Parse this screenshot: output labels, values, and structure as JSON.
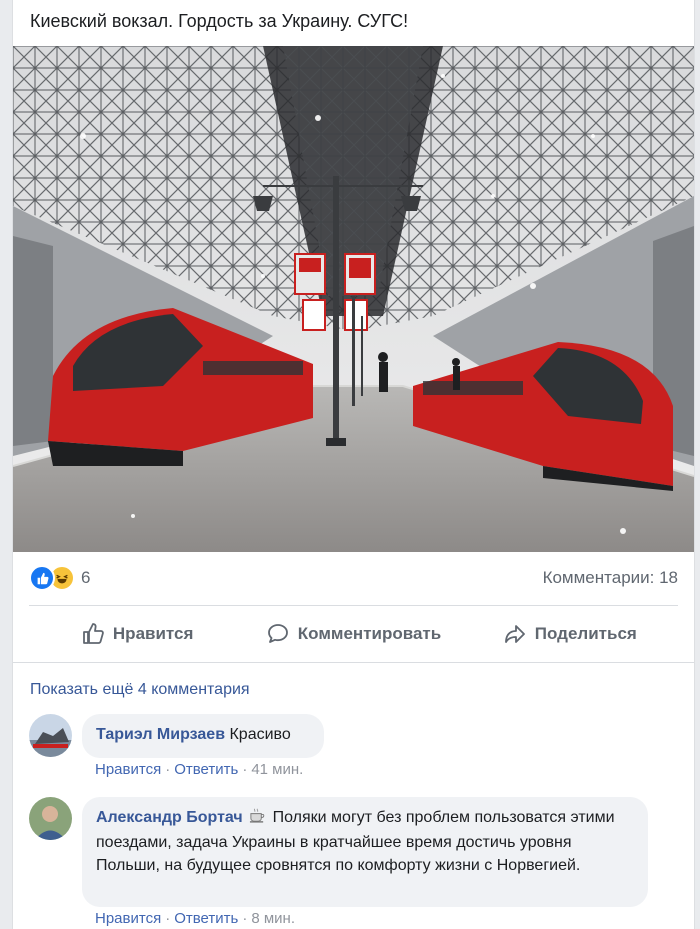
{
  "post": {
    "text": "Киевский вокзал. Гордость за Украину. СУГС!",
    "reactions": {
      "icons": [
        "like-icon",
        "haha-icon"
      ],
      "count": "6"
    },
    "comments_count": "Комментарии: 18",
    "actions": {
      "like": "Нравится",
      "comment": "Комментировать",
      "share": "Поделиться"
    }
  },
  "comments": {
    "show_more": "Показать ещё 4 комментария",
    "items": [
      {
        "author": "Тариэл Мирзаев",
        "text": "Красиво",
        "like": "Нравится",
        "reply": "Ответить",
        "time": "41 мин."
      },
      {
        "author": "Александр Бортач",
        "emoji": "coffee-icon",
        "text": "Поляки могут без проблем пользоватся этими поездами, задача Украины в кратчайшее время достичь уровня Польши, на будущее сровнятся по комфорту жизни с Норвегией.",
        "like": "Нравится",
        "reply": "Ответить",
        "time": "8 мин."
      }
    ]
  },
  "colors": {
    "link": "#385898",
    "meta": "#90949c",
    "bubble": "#f0f2f5",
    "train_red": "#c8201f"
  }
}
